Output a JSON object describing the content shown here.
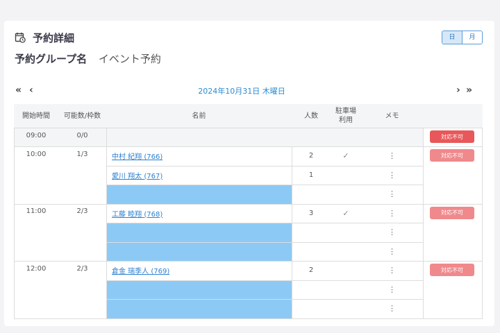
{
  "header": {
    "title": "予約詳細",
    "icon": "calendar-clock-icon",
    "view_toggle": [
      {
        "label": "日",
        "active": true
      },
      {
        "label": "月",
        "active": false
      }
    ]
  },
  "group": {
    "label": "予約グループ名",
    "value": "イベント予約"
  },
  "nav": {
    "prev_double": "«",
    "prev": "‹",
    "next": "›",
    "next_double": "»",
    "date": "2024年10月31日 木曜日"
  },
  "table": {
    "columns": {
      "start_time": "開始時間",
      "capacity": "可能数/枠数",
      "name": "名前",
      "people": "人数",
      "parking": "駐車場\n利用",
      "memo": "メモ"
    },
    "status_label": "対応不可",
    "colors": {
      "status_primary": "#e8585a",
      "status_light": "#f0898c",
      "empty_slot": "#8ccaf5",
      "link": "#2a7fd0",
      "date": "#2a8bd0"
    },
    "groups": [
      {
        "time": "09:00",
        "capacity": "0/0",
        "status": "primary",
        "rows": []
      },
      {
        "time": "10:00",
        "capacity": "1/3",
        "status": "light",
        "rows": [
          {
            "name": "中村 紀翔 (766)",
            "people": "2",
            "parking": "✓"
          },
          {
            "name": "愛川 翔太 (767)",
            "people": "1",
            "parking": ""
          },
          null
        ]
      },
      {
        "time": "11:00",
        "capacity": "2/3",
        "status": "light",
        "rows": [
          {
            "name": "工藤 睦翔 (768)",
            "people": "3",
            "parking": "✓"
          },
          null,
          null
        ]
      },
      {
        "time": "12:00",
        "capacity": "2/3",
        "status": "light",
        "rows": [
          {
            "name": "倉金 瑞季人 (769)",
            "people": "2",
            "parking": ""
          },
          null,
          null
        ]
      }
    ]
  }
}
